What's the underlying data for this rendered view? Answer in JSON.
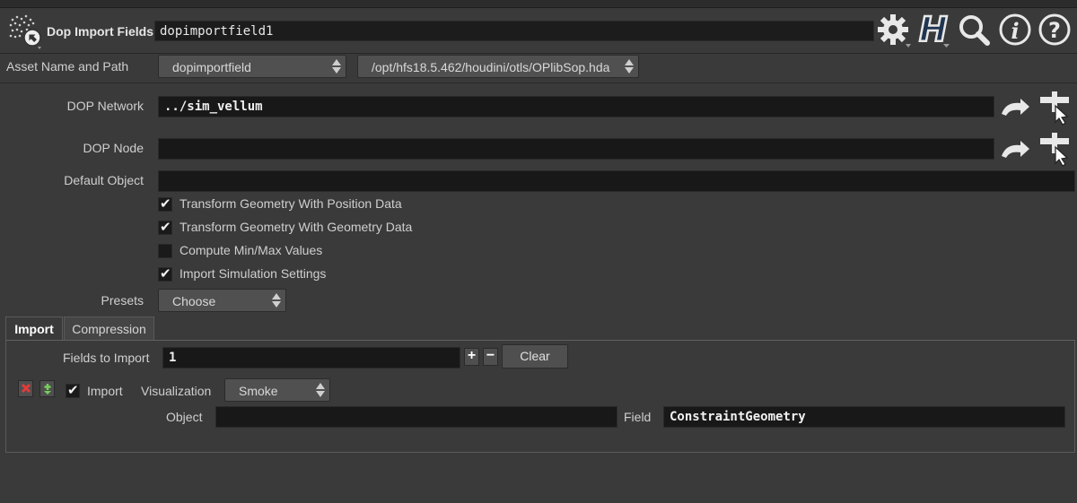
{
  "node": {
    "type_label": "Dop Import Fields",
    "name": "dopimportfield1",
    "icons": [
      "gear-icon",
      "houdini-help-icon",
      "magnifier-icon",
      "info-icon",
      "question-icon"
    ]
  },
  "asset": {
    "label": "Asset Name and Path",
    "name": "dopimportfield",
    "path": "/opt/hfs18.5.462/houdini/otls/OPlibSop.hda"
  },
  "params": {
    "dop_network": {
      "label": "DOP Network",
      "value": "../sim_vellum"
    },
    "dop_node": {
      "label": "DOP Node",
      "value": ""
    },
    "default_object": {
      "label": "Default Object",
      "value": ""
    },
    "checkboxes": [
      {
        "label": "Transform Geometry With Position Data",
        "checked": true
      },
      {
        "label": "Transform Geometry With Geometry Data",
        "checked": true
      },
      {
        "label": "Compute Min/Max Values",
        "checked": false
      },
      {
        "label": "Import Simulation Settings",
        "checked": true
      }
    ],
    "presets": {
      "label": "Presets",
      "value": "Choose"
    }
  },
  "tabs": [
    {
      "label": "Import",
      "active": true
    },
    {
      "label": "Compression",
      "active": false
    }
  ],
  "import_tab": {
    "fields_label": "Fields to Import",
    "fields_value": "1",
    "plus": "+",
    "minus": "−",
    "clear_label": "Clear",
    "entry": {
      "remove_icon": "x-icon",
      "insert_icon": "insert-icon",
      "import_label": "Import",
      "import_checked": true,
      "visualization_label": "Visualization",
      "visualization_value": "Smoke",
      "object_label": "Object",
      "object_value": "",
      "field_label": "Field",
      "field_value": "ConstraintGeometry"
    }
  },
  "colors": {
    "background": "#3a3a3a",
    "field_bg": "#181818",
    "button_bg": "#4f4f4f"
  }
}
